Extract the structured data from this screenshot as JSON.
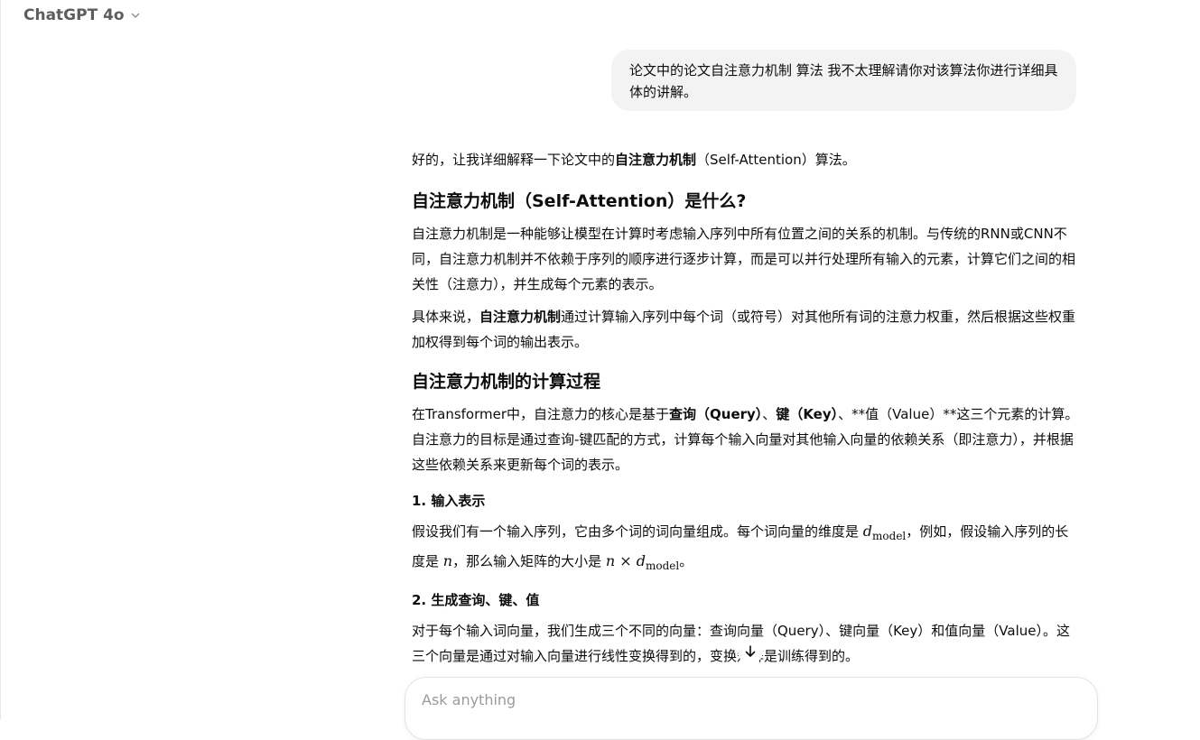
{
  "header": {
    "model_name": "ChatGPT 4o",
    "chevron_icon": "chevron-down-icon"
  },
  "user_message": {
    "text": "论文中的论文自注意力机制 算法 我不太理解请你对该算法你进行详细具体的讲解。"
  },
  "assistant": {
    "intro_pre": "好的，让我详细解释一下论文中的",
    "intro_bold": "自注意力机制",
    "intro_post": "（Self-Attention）算法。",
    "h_what": "自注意力机制（Self-Attention）是什么?",
    "p_def1": "自注意力机制是一种能够让模型在计算时考虑输入序列中所有位置之间的关系的机制。与传统的RNN或CNN不同，自注意力机制并不依赖于序列的顺序进行逐步计算，而是可以并行处理所有输入的元素，计算它们之间的相关性（注意力），并生成每个元素的表示。",
    "p_def2_pre": "具体来说，",
    "p_def2_bold": "自注意力机制",
    "p_def2_post": "通过计算输入序列中每个词（或符号）对其他所有词的注意力权重，然后根据这些权重加权得到每个词的输出表示。",
    "h_process": "自注意力机制的计算过程",
    "p_proc_1": "在Transformer中，自注意力的核心是基于",
    "p_proc_bold1": "查询（Query）",
    "p_proc_2": "、",
    "p_proc_bold2": "键（Key）",
    "p_proc_3": "、**值（Value）**这三个元素的计算。自注意力的目标是通过查询-键匹配的方式，计算每个输入向量对其他输入向量的依赖关系（即注意力），并根据这些依赖关系来更新每个词的表示。",
    "h_step1": "1. 输入表示",
    "p_step1_a": "假设我们有一个输入序列，它由多个词的词向量组成。每个词向量的维度是 ",
    "math_d": "d",
    "math_sub": "model",
    "p_step1_b": "，例如，假设输入序列的长度是 ",
    "math_n": "n",
    "p_step1_c": "，那么输入矩阵的大小是 ",
    "math_n2": "n",
    "math_times": " × ",
    "math_d2": "d",
    "math_sub2": "model",
    "p_step1_d": "。",
    "h_step2": "2. 生成查询、键、值",
    "p_step2": "对于每个输入词向量，我们生成三个不同的向量：查询向量（Query）、键向量（Key）和值向量（Value）。这三个向量是通过对输入向量进行线性变换得到的，变换矩阵是训练得到的。"
  },
  "scroll_button": {
    "icon": "arrow-down-icon"
  },
  "composer": {
    "placeholder": "Ask anything",
    "value": ""
  },
  "colors": {
    "user_bubble_bg": "#f3f3f3",
    "text": "#0d0d0d",
    "model_name": "#5d5d5d",
    "placeholder": "#9b9b9b"
  }
}
